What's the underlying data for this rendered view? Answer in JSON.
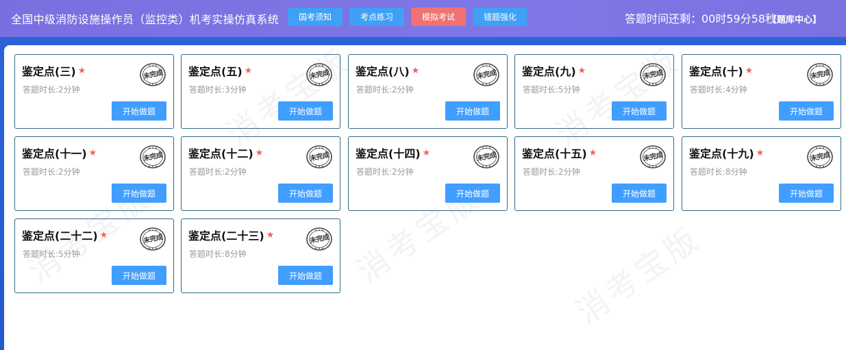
{
  "header": {
    "title": "全国中级消防设施操作员（监控类）机考实操仿真系统",
    "nav": [
      {
        "label": "国考须知",
        "color": "#3fa0f5"
      },
      {
        "label": "考点练习",
        "color": "#3fa0f5"
      },
      {
        "label": "模拟考试",
        "color": "#f07272"
      },
      {
        "label": "错题强化",
        "color": "#3fa0f5"
      }
    ],
    "timer": "答题时间还剩：00时59分58秒",
    "bank_link": "【题库中心】"
  },
  "watermark": "消考宝版",
  "cards": [
    {
      "title": "鉴定点(三)",
      "duration": "答题时长:2分钟",
      "stamp": "未完成",
      "button": "开始做题"
    },
    {
      "title": "鉴定点(五)",
      "duration": "答题时长:3分钟",
      "stamp": "未完成",
      "button": "开始做题"
    },
    {
      "title": "鉴定点(八)",
      "duration": "答题时长:2分钟",
      "stamp": "未完成",
      "button": "开始做题"
    },
    {
      "title": "鉴定点(九)",
      "duration": "答题时长:5分钟",
      "stamp": "未完成",
      "button": "开始做题"
    },
    {
      "title": "鉴定点(十)",
      "duration": "答题时长:4分钟",
      "stamp": "未完成",
      "button": "开始做题"
    },
    {
      "title": "鉴定点(十一)",
      "duration": "答题时长:2分钟",
      "stamp": "未完成",
      "button": "开始做题"
    },
    {
      "title": "鉴定点(十二)",
      "duration": "答题时长:2分钟",
      "stamp": "未完成",
      "button": "开始做题"
    },
    {
      "title": "鉴定点(十四)",
      "duration": "答题时长:2分钟",
      "stamp": "未完成",
      "button": "开始做题"
    },
    {
      "title": "鉴定点(十五)",
      "duration": "答题时长:2分钟",
      "stamp": "未完成",
      "button": "开始做题"
    },
    {
      "title": "鉴定点(十九)",
      "duration": "答题时长:8分钟",
      "stamp": "未完成",
      "button": "开始做题"
    },
    {
      "title": "鉴定点(二十二)",
      "duration": "答题时长:5分钟",
      "stamp": "未完成",
      "button": "开始做题"
    },
    {
      "title": "鉴定点(二十三)",
      "duration": "答题时长:8分钟",
      "stamp": "未完成",
      "button": "开始做题"
    }
  ],
  "colors": {
    "header_bg": "#7b72e2",
    "frame_bg": "#2458cf",
    "nav_blue": "#3fa0f5",
    "nav_red": "#f07272",
    "start_button": "#409eff",
    "star": "#ef6363",
    "card_border": "#2e6a82"
  }
}
